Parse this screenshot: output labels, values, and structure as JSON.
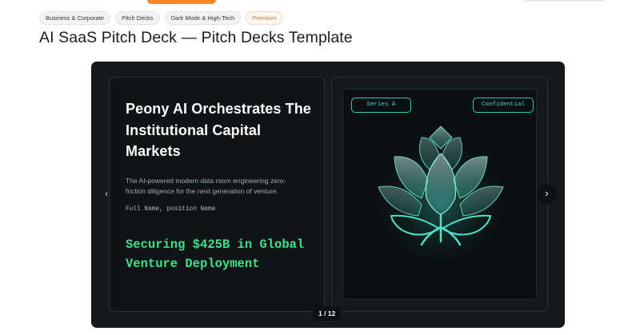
{
  "tags": [
    "Business & Corporate",
    "Pitch Decks",
    "Dark Mode & High-Tech",
    "Premium"
  ],
  "page_title": "AI SaaS Pitch Deck — Pitch Decks Template",
  "slide": {
    "headline": "Peony AI Orchestrates The Institutional Capital Markets",
    "description": "The AI-powered modern data room engineering zero-friction diligence for the next generation of venture.",
    "person": "Full Name, position Name",
    "callout": "Securing $425B in Global Venture Deployment",
    "badge_left": "Series A",
    "badge_right": "Confidential"
  },
  "pager": "1 / 12",
  "icons": {
    "prev": "chevron-left-icon",
    "next": "chevron-right-icon",
    "logo": "lotus-icon"
  },
  "colors": {
    "accent_orange": "#f0872a",
    "callout_green": "#3fe08a",
    "badge_teal": "#2fc6c8",
    "slide_bg": "#0f1416"
  }
}
